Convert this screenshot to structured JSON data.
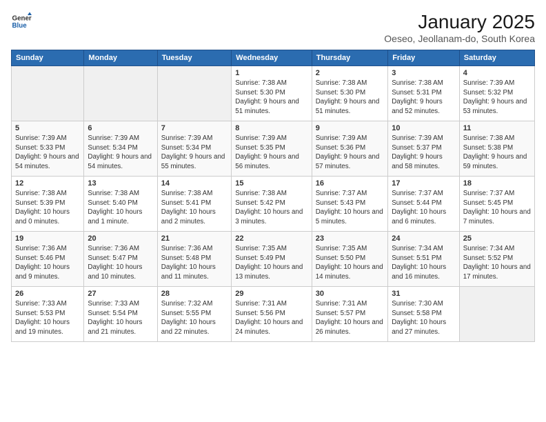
{
  "header": {
    "logo_general": "General",
    "logo_blue": "Blue",
    "title": "January 2025",
    "subtitle": "Oeseo, Jeollanam-do, South Korea"
  },
  "days_of_week": [
    "Sunday",
    "Monday",
    "Tuesday",
    "Wednesday",
    "Thursday",
    "Friday",
    "Saturday"
  ],
  "weeks": [
    [
      {
        "day": "",
        "info": ""
      },
      {
        "day": "",
        "info": ""
      },
      {
        "day": "",
        "info": ""
      },
      {
        "day": "1",
        "info": "Sunrise: 7:38 AM\nSunset: 5:30 PM\nDaylight: 9 hours and 51 minutes."
      },
      {
        "day": "2",
        "info": "Sunrise: 7:38 AM\nSunset: 5:30 PM\nDaylight: 9 hours and 51 minutes."
      },
      {
        "day": "3",
        "info": "Sunrise: 7:38 AM\nSunset: 5:31 PM\nDaylight: 9 hours and 52 minutes."
      },
      {
        "day": "4",
        "info": "Sunrise: 7:39 AM\nSunset: 5:32 PM\nDaylight: 9 hours and 53 minutes."
      }
    ],
    [
      {
        "day": "5",
        "info": "Sunrise: 7:39 AM\nSunset: 5:33 PM\nDaylight: 9 hours and 54 minutes."
      },
      {
        "day": "6",
        "info": "Sunrise: 7:39 AM\nSunset: 5:34 PM\nDaylight: 9 hours and 54 minutes."
      },
      {
        "day": "7",
        "info": "Sunrise: 7:39 AM\nSunset: 5:34 PM\nDaylight: 9 hours and 55 minutes."
      },
      {
        "day": "8",
        "info": "Sunrise: 7:39 AM\nSunset: 5:35 PM\nDaylight: 9 hours and 56 minutes."
      },
      {
        "day": "9",
        "info": "Sunrise: 7:39 AM\nSunset: 5:36 PM\nDaylight: 9 hours and 57 minutes."
      },
      {
        "day": "10",
        "info": "Sunrise: 7:39 AM\nSunset: 5:37 PM\nDaylight: 9 hours and 58 minutes."
      },
      {
        "day": "11",
        "info": "Sunrise: 7:38 AM\nSunset: 5:38 PM\nDaylight: 9 hours and 59 minutes."
      }
    ],
    [
      {
        "day": "12",
        "info": "Sunrise: 7:38 AM\nSunset: 5:39 PM\nDaylight: 10 hours and 0 minutes."
      },
      {
        "day": "13",
        "info": "Sunrise: 7:38 AM\nSunset: 5:40 PM\nDaylight: 10 hours and 1 minute."
      },
      {
        "day": "14",
        "info": "Sunrise: 7:38 AM\nSunset: 5:41 PM\nDaylight: 10 hours and 2 minutes."
      },
      {
        "day": "15",
        "info": "Sunrise: 7:38 AM\nSunset: 5:42 PM\nDaylight: 10 hours and 3 minutes."
      },
      {
        "day": "16",
        "info": "Sunrise: 7:37 AM\nSunset: 5:43 PM\nDaylight: 10 hours and 5 minutes."
      },
      {
        "day": "17",
        "info": "Sunrise: 7:37 AM\nSunset: 5:44 PM\nDaylight: 10 hours and 6 minutes."
      },
      {
        "day": "18",
        "info": "Sunrise: 7:37 AM\nSunset: 5:45 PM\nDaylight: 10 hours and 7 minutes."
      }
    ],
    [
      {
        "day": "19",
        "info": "Sunrise: 7:36 AM\nSunset: 5:46 PM\nDaylight: 10 hours and 9 minutes."
      },
      {
        "day": "20",
        "info": "Sunrise: 7:36 AM\nSunset: 5:47 PM\nDaylight: 10 hours and 10 minutes."
      },
      {
        "day": "21",
        "info": "Sunrise: 7:36 AM\nSunset: 5:48 PM\nDaylight: 10 hours and 11 minutes."
      },
      {
        "day": "22",
        "info": "Sunrise: 7:35 AM\nSunset: 5:49 PM\nDaylight: 10 hours and 13 minutes."
      },
      {
        "day": "23",
        "info": "Sunrise: 7:35 AM\nSunset: 5:50 PM\nDaylight: 10 hours and 14 minutes."
      },
      {
        "day": "24",
        "info": "Sunrise: 7:34 AM\nSunset: 5:51 PM\nDaylight: 10 hours and 16 minutes."
      },
      {
        "day": "25",
        "info": "Sunrise: 7:34 AM\nSunset: 5:52 PM\nDaylight: 10 hours and 17 minutes."
      }
    ],
    [
      {
        "day": "26",
        "info": "Sunrise: 7:33 AM\nSunset: 5:53 PM\nDaylight: 10 hours and 19 minutes."
      },
      {
        "day": "27",
        "info": "Sunrise: 7:33 AM\nSunset: 5:54 PM\nDaylight: 10 hours and 21 minutes."
      },
      {
        "day": "28",
        "info": "Sunrise: 7:32 AM\nSunset: 5:55 PM\nDaylight: 10 hours and 22 minutes."
      },
      {
        "day": "29",
        "info": "Sunrise: 7:31 AM\nSunset: 5:56 PM\nDaylight: 10 hours and 24 minutes."
      },
      {
        "day": "30",
        "info": "Sunrise: 7:31 AM\nSunset: 5:57 PM\nDaylight: 10 hours and 26 minutes."
      },
      {
        "day": "31",
        "info": "Sunrise: 7:30 AM\nSunset: 5:58 PM\nDaylight: 10 hours and 27 minutes."
      },
      {
        "day": "",
        "info": ""
      }
    ]
  ]
}
